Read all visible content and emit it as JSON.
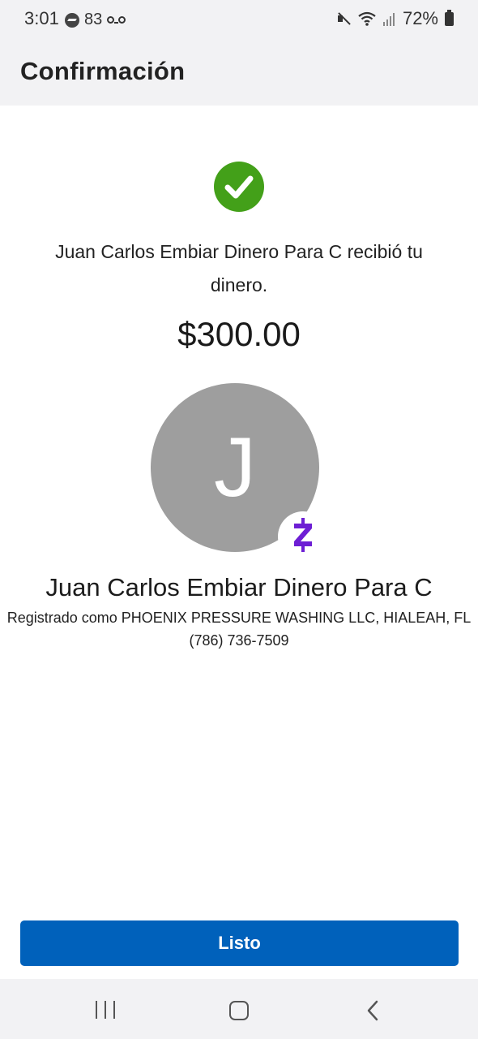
{
  "status_bar": {
    "time": "3:01",
    "notification_count": "83",
    "battery": "72%"
  },
  "header": {
    "title": "Confirmación"
  },
  "confirmation": {
    "message": "Juan Carlos Embiar Dinero Para C recibió tu dinero.",
    "amount": "$300.00",
    "avatar_initial": "J",
    "recipient_name": "Juan Carlos Embiar Dinero Para C",
    "registered_as": "Registrado como PHOENIX PRESSURE WASHING LLC, HIALEAH, FL",
    "phone": "(786) 736-7509"
  },
  "actions": {
    "done_label": "Listo"
  },
  "colors": {
    "success": "#43a019",
    "primary": "#0061bb",
    "zelle": "#6d1ed4",
    "avatar_bg": "#9e9e9e"
  },
  "icons": {
    "success": "check-circle-icon",
    "zelle": "zelle-logo-icon",
    "nav_recents": "recents-icon",
    "nav_home": "home-icon",
    "nav_back": "back-icon"
  }
}
